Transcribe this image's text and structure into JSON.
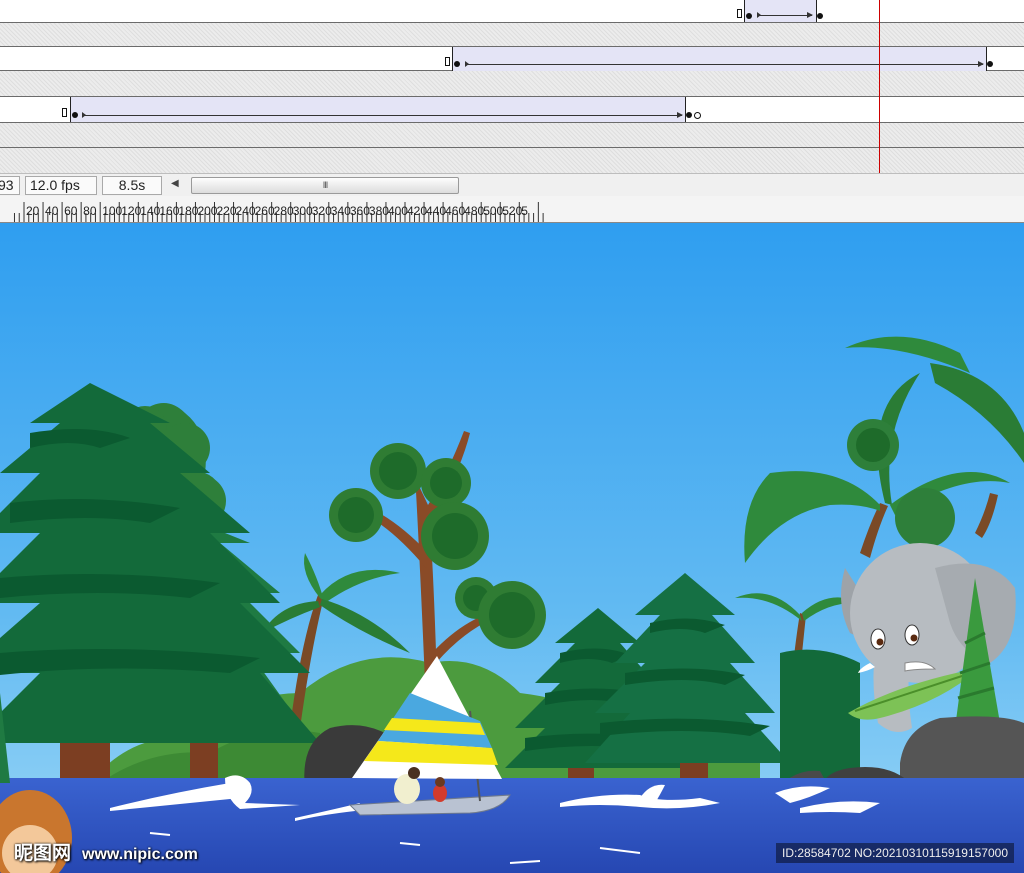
{
  "timeline": {
    "frame_counter": "93",
    "frame_rate": "12.0 fps",
    "elapsed_time": "8.5s",
    "scroll_thumb_glyph": "III"
  },
  "ruler": {
    "ticks": [
      "20",
      "40",
      "60",
      "80",
      "100",
      "120",
      "140",
      "160",
      "180",
      "200",
      "220",
      "240",
      "260",
      "280",
      "300",
      "320",
      "340",
      "360",
      "380",
      "400",
      "420",
      "440",
      "460",
      "480",
      "500",
      "520",
      "5"
    ]
  },
  "watermark": {
    "logo_text": "昵图网",
    "url": "www.nipic.com",
    "id_text": "ID:28584702 NO:20210310115919157000"
  },
  "colors": {
    "sky_top": "#2f9ef0",
    "sky_bottom": "#8fd0f5",
    "water": "#2d55c6",
    "pine_dark": "#0f6b3a",
    "pine_light": "#1f8a4a",
    "playhead": "#cc0000",
    "tween_fill": "#e4e4f6"
  }
}
